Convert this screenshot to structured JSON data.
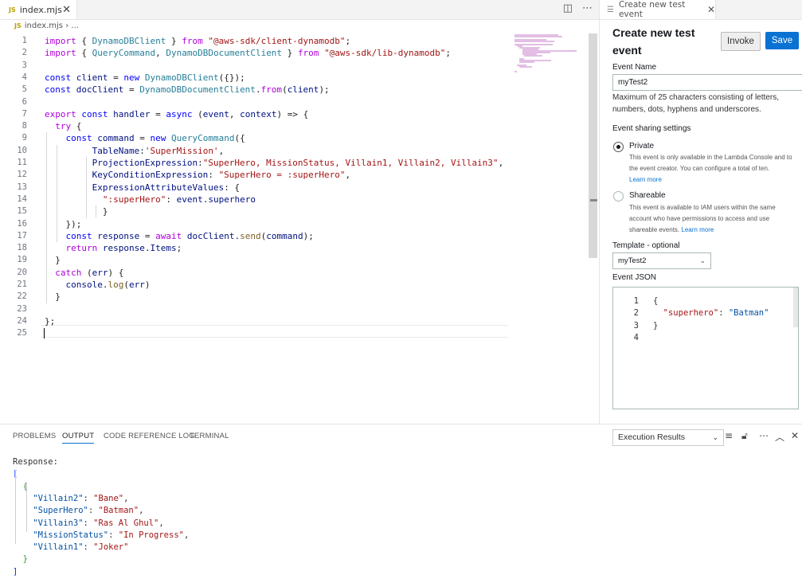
{
  "editor": {
    "tab_label": "index.mjs",
    "breadcrumb_file": "index.mjs",
    "breadcrumb_rest": "...",
    "lines": [
      {
        "n": "1",
        "code": "import { DynamoDBClient } from \"@aws-sdk/client-dynamodb\";"
      },
      {
        "n": "2",
        "code": "import { QueryCommand, DynamoDBDocumentClient } from \"@aws-sdk/lib-dynamodb\";"
      },
      {
        "n": "3",
        "code": ""
      },
      {
        "n": "4",
        "code": "const client = new DynamoDBClient({});"
      },
      {
        "n": "5",
        "code": "const docClient = DynamoDBDocumentClient.from(client);"
      },
      {
        "n": "6",
        "code": ""
      },
      {
        "n": "7",
        "code": "export const handler = async (event, context) => {"
      },
      {
        "n": "8",
        "code": "  try {"
      },
      {
        "n": "9",
        "code": "    const command = new QueryCommand({"
      },
      {
        "n": "10",
        "code": "         TableName:'SuperMission',"
      },
      {
        "n": "11",
        "code": "         ProjectionExpression:\"SuperHero, MissionStatus, Villain1, Villain2, Villain3\","
      },
      {
        "n": "12",
        "code": "         KeyConditionExpression: \"SuperHero = :superHero\","
      },
      {
        "n": "13",
        "code": "         ExpressionAttributeValues: {"
      },
      {
        "n": "14",
        "code": "           \":superHero\": event.superhero"
      },
      {
        "n": "15",
        "code": "           }"
      },
      {
        "n": "16",
        "code": "    });"
      },
      {
        "n": "17",
        "code": "    const response = await docClient.send(command);"
      },
      {
        "n": "18",
        "code": "    return response.Items;"
      },
      {
        "n": "19",
        "code": "  }"
      },
      {
        "n": "20",
        "code": "  catch (err) {"
      },
      {
        "n": "21",
        "code": "    console.log(err)"
      },
      {
        "n": "22",
        "code": "  }"
      },
      {
        "n": "23",
        "code": ""
      },
      {
        "n": "24",
        "code": "};"
      },
      {
        "n": "25",
        "code": ""
      }
    ]
  },
  "test_panel": {
    "tab_label": "Create new test event",
    "title": "Create new test event",
    "invoke_label": "Invoke",
    "save_label": "Save",
    "event_name_label": "Event Name",
    "event_name_value": "myTest2",
    "event_name_hint": "Maximum of 25 characters consisting of letters, numbers, dots, hyphens and underscores.",
    "sharing_label": "Event sharing settings",
    "private_label": "Private",
    "private_desc": "This event is only available in the Lambda Console and to the event creator. You can configure a total of ten.",
    "learn_more": "Learn more",
    "shareable_label": "Shareable",
    "shareable_desc": "This event is available to IAM users within the same account who have permissions to access and use shareable events.",
    "template_label": "Template - optional",
    "template_value": "myTest2",
    "json_label": "Event JSON",
    "json_lines": [
      {
        "n": "1",
        "code": "{"
      },
      {
        "n": "2",
        "code": "  \"superhero\": \"Batman\""
      },
      {
        "n": "3",
        "code": "}"
      },
      {
        "n": "4",
        "code": ""
      }
    ]
  },
  "bottom_panel": {
    "tabs": [
      "PROBLEMS",
      "OUTPUT",
      "CODE REFERENCE LOG",
      "TERMINAL"
    ],
    "active_tab": "OUTPUT",
    "output_channel": "Execution Results",
    "output_lines": [
      "Response:",
      "[",
      "  {",
      "    \"Villain2\": \"Bane\",",
      "    \"SuperHero\": \"Batman\",",
      "    \"Villain3\": \"Ras Al Ghul\",",
      "    \"MissionStatus\": \"In Progress\",",
      "    \"Villain1\": \"Joker\"",
      "  }",
      "]"
    ]
  },
  "colors": {
    "accent": "#0972d3",
    "keyword": "#0000ff",
    "control": "#af00db",
    "string": "#a31515",
    "variable": "#001080",
    "function": "#795e26",
    "type": "#267f99"
  }
}
